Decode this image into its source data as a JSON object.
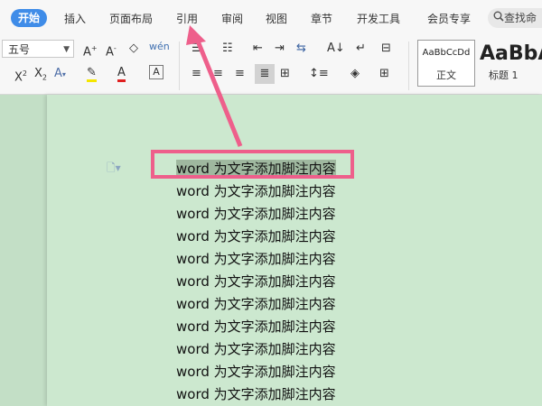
{
  "menu": {
    "tabs": [
      "开始",
      "插入",
      "页面布局",
      "引用",
      "审阅",
      "视图",
      "章节",
      "开发工具",
      "会员专享"
    ],
    "active_tab": "开始",
    "search_label": "查找命"
  },
  "ribbon": {
    "font_size_value": "五号",
    "font_size_dropdown_icon": "chevron-down-icon",
    "styles": [
      {
        "sample": "AaBbCcDd",
        "name": "正文"
      },
      {
        "sample": "AaBbA",
        "name": "标题 1"
      }
    ],
    "icons": [
      "increase-font-icon",
      "decrease-font-icon",
      "clear-format-icon",
      "phonetic-guide-icon",
      "superscript-icon",
      "subscript-icon",
      "text-effect-icon",
      "highlight-icon",
      "font-color-icon",
      "char-border-icon",
      "bullet-list-icon",
      "numbered-list-icon",
      "decrease-indent-icon",
      "increase-indent-icon",
      "chinese-layout-icon",
      "show-marks-icon",
      "sort-icon",
      "table-icon",
      "align-left-icon",
      "align-center-icon",
      "align-right-icon",
      "justify-icon",
      "distributed-icon",
      "line-spacing-icon",
      "shading-icon",
      "border-icon"
    ]
  },
  "colors": {
    "accent": "#3f8ce8",
    "annotation": "#ee5f8b",
    "doc_background": "#cce8cf",
    "selection": "#9fb89f"
  },
  "document": {
    "lines": [
      "word 为文字添加脚注内容",
      "word 为文字添加脚注内容",
      "word 为文字添加脚注内容",
      "word 为文字添加脚注内容",
      "word 为文字添加脚注内容",
      "word 为文字添加脚注内容",
      "word 为文字添加脚注内容",
      "word 为文字添加脚注内容",
      "word 为文字添加脚注内容",
      "word 为文字添加脚注内容",
      "word 为文字添加脚注内容"
    ],
    "selected_line_index": 0
  }
}
